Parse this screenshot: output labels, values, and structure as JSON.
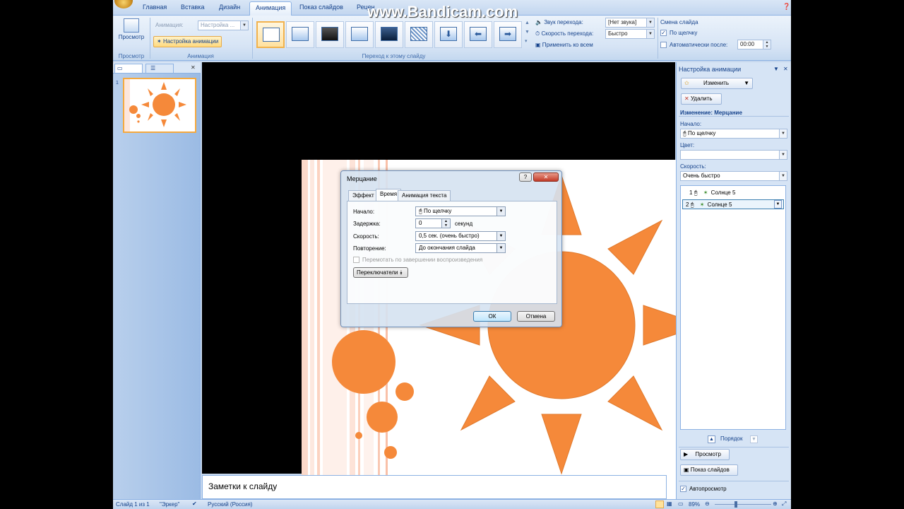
{
  "watermark": "www.Bandicam.com",
  "ribbon": {
    "tabs": [
      "Главная",
      "Вставка",
      "Дизайн",
      "Анимация",
      "Показ слайдов",
      "Рецен"
    ],
    "preview_label": "Просмотр",
    "preview_group_label": "Просмотр",
    "animation_label": "Анимация:",
    "animation_value": "Настройка ...",
    "custom_animation_label": "Настройка анимации",
    "animation_group_label": "Анимация",
    "transition_group_label": "Переход к этому слайду",
    "sound_label": "Звук перехода:",
    "sound_value": "[Нет звука]",
    "speed_label": "Скорость перехода:",
    "speed_value": "Быстро",
    "apply_all_label": "Применить ко всем",
    "advance_title": "Смена слайда",
    "on_click_label": "По щелчку",
    "auto_after_label": "Автоматически после:",
    "auto_after_value": "00:00"
  },
  "slide_panel": {
    "slide_number": "1"
  },
  "dialog": {
    "title": "Мерцание",
    "help": "?",
    "close": "✕",
    "tabs": [
      "Эффект",
      "Время",
      "Анимация текста"
    ],
    "start_label": "Начало:",
    "start_value": "По щелчку",
    "delay_label": "Задержка:",
    "delay_value": "0",
    "delay_unit": "секунд",
    "speed_label": "Скорость:",
    "speed_value": "0,5 сек. (очень быстро)",
    "repeat_label": "Повторение:",
    "repeat_value": "До окончания слайда",
    "rewind_label": "Перемотать по завершении воспроизведения",
    "triggers_label": "Переключатели",
    "ok_label": "ОК",
    "cancel_label": "Отмена"
  },
  "notes": {
    "text": "Заметки к слайду"
  },
  "statusbar": {
    "slide_info": "Слайд 1 из 1",
    "theme": "\"Эркер\"",
    "language": "Русский (Россия)",
    "zoom": "89%"
  },
  "taskpane": {
    "title": "Настройка анимации",
    "change_label": "Изменить",
    "delete_label": "Удалить",
    "modify_title": "Изменение: Мерцание",
    "start_label": "Начало:",
    "start_value": "По щелчку",
    "color_label": "Цвет:",
    "color_value": "",
    "speed_label": "Скорость:",
    "speed_value": "Очень быстро",
    "items": [
      {
        "num": "1",
        "label": "Солнце 5"
      },
      {
        "num": "2",
        "label": "Солнце 5"
      }
    ],
    "order_label": "Порядок",
    "play_label": "Просмотр",
    "slideshow_label": "Показ слайдов",
    "autopreview_label": "Автопросмотр"
  },
  "colors": {
    "accent_orange": "#f5893a",
    "ribbon_blue": "#15428b",
    "selection_border": "#f2b24c"
  }
}
